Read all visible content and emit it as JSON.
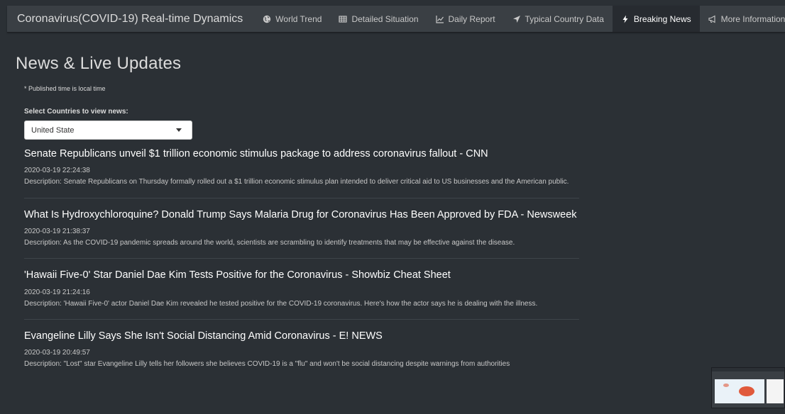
{
  "nav": {
    "brand": "Coronavirus(COVID-19) Real-time Dynamics",
    "items": [
      {
        "label": "World Trend",
        "icon": "globe-icon"
      },
      {
        "label": "Detailed Situation",
        "icon": "table-icon"
      },
      {
        "label": "Daily Report",
        "icon": "line-chart-icon"
      },
      {
        "label": "Typical Country Data",
        "icon": "location-arrow-icon"
      },
      {
        "label": "Breaking News",
        "icon": "bolt-icon"
      },
      {
        "label": "More Information",
        "icon": "bullhorn-icon"
      }
    ],
    "active_index": 4
  },
  "page": {
    "title": "News & Live Updates",
    "note": "* Published time is local time",
    "select_label": "Select Countries to view news:",
    "selected_country": "United State"
  },
  "news": [
    {
      "title": "Senate Republicans unveil $1 trillion economic stimulus package to address coronavirus fallout - CNN",
      "time": "2020-03-19 22:24:38",
      "description": "Description: Senate Republicans on Thursday formally rolled out a $1 trillion economic stimulus plan intended to deliver critical aid to US businesses and the American public."
    },
    {
      "title": "What Is Hydroxychloroquine? Donald Trump Says Malaria Drug for Coronavirus Has Been Approved by FDA - Newsweek",
      "time": "2020-03-19 21:38:37",
      "description": "Description: As the COVID-19 pandemic spreads around the world, scientists are scrambling to identify treatments that may be effective against the disease."
    },
    {
      "title": "'Hawaii Five-0' Star Daniel Dae Kim Tests Positive for the Coronavirus - Showbiz Cheat Sheet",
      "time": "2020-03-19 21:24:16",
      "description": "Description: 'Hawaii Five-0' actor Daniel Dae Kim revealed he tested positive for the COVID-19 coronavirus. Here's how the actor says he is dealing with the illness."
    },
    {
      "title": "Evangeline Lilly Says She Isn't Social Distancing Amid Coronavirus - E! NEWS",
      "time": "2020-03-19 20:49:57",
      "description": "Description: \"Lost\" star Evangeline Lilly tells her followers she believes COVID-19 is a \"flu\" and won't be social distancing despite warnings from authorities"
    }
  ],
  "colors": {
    "background": "#2b3035",
    "navbar": "#3a3f44",
    "active_tab": "#272b30"
  }
}
